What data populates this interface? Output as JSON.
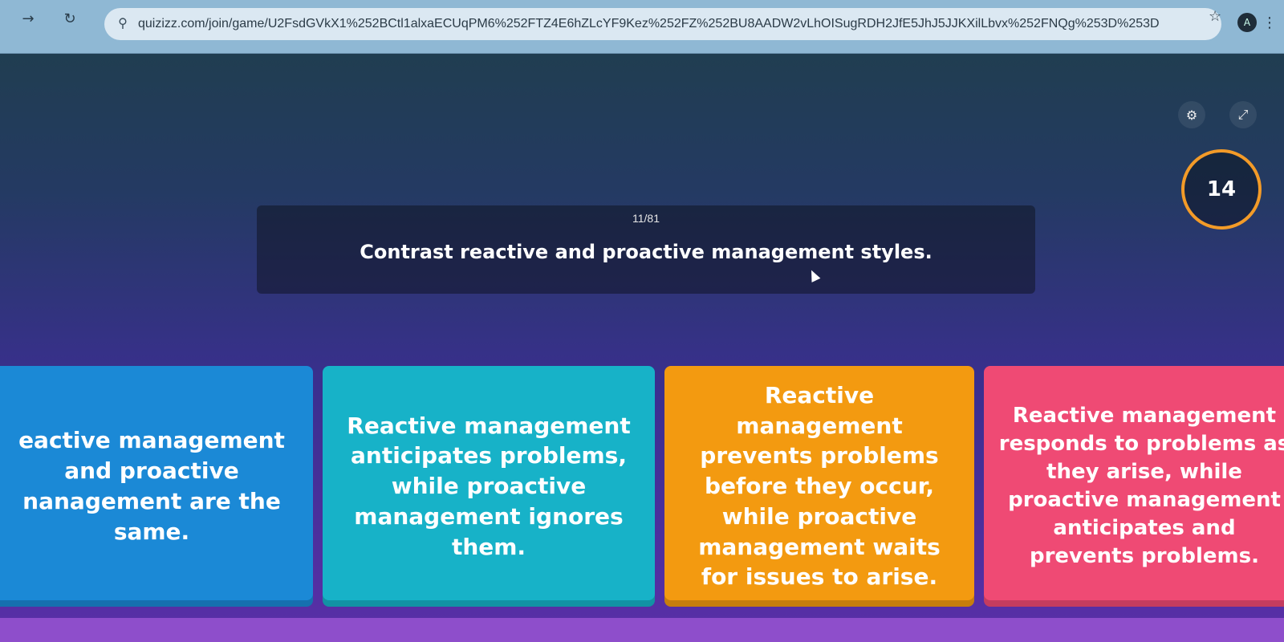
{
  "browser": {
    "url": "quizizz.com/join/game/U2FsdGVkX1%252BCtl1alxaECUqPM6%252FTZ4E6hZLcYF9Kez%252FZ%252BU8AADW2vLhOISugRDH2JfE5JhJ5JJKXilLbvx%252FNQg%253D%253D",
    "icons": [
      "back-arrow-icon",
      "reload-icon",
      "site-info-icon",
      "star-icon",
      "profile-avatar-icon",
      "menu-dots-icon"
    ]
  },
  "game": {
    "counter": "11/81",
    "question": "Contrast reactive and proactive management styles.",
    "timer": "14",
    "answers": [
      {
        "text": "eactive management and proactive nanagement are the same.",
        "color": "#1b89d6"
      },
      {
        "text": "Reactive management anticipates problems, while proactive management ignores them.",
        "color": "#17b2c8"
      },
      {
        "text": "Reactive management prevents problems before they occur, while proactive management waits for issues to arise.",
        "color": "#f39a10"
      },
      {
        "text": "Reactive management responds to problems as they arise, while proactive management anticipates and prevents problems.",
        "color": "#ef4a74"
      }
    ],
    "top_icons": [
      "settings-icon",
      "fullscreen-icon"
    ]
  }
}
